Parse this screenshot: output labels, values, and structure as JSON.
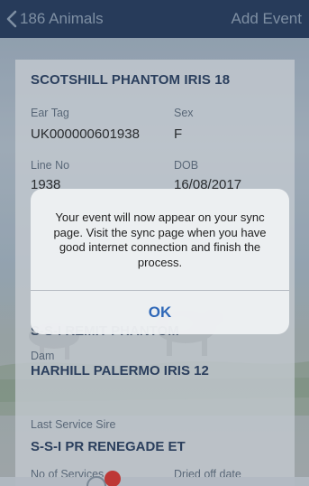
{
  "nav": {
    "back_label": "186 Animals",
    "action_label": "Add Event",
    "back_icon": "chevron-left-icon"
  },
  "animal": {
    "name": "SCOTSHILL PHANTOM IRIS 18",
    "ear_tag_label": "Ear Tag",
    "ear_tag_value": "UK000000601938",
    "sex_label": "Sex",
    "sex_value": "F",
    "line_no_label": "Line No",
    "line_no_value": "1938",
    "dob_label": "DOB",
    "dob_value": "16/08/2017",
    "sire_partial": "S-S-I REMIT PHANTOM",
    "dam_label": "Dam",
    "dam_value": "HARHILL PALERMO IRIS 12",
    "last_service_sire_label": "Last Service Sire",
    "last_service_sire_value": "S-S-I PR RENEGADE ET",
    "no_of_services_label": "No of Services",
    "dried_off_date_label": "Dried off date"
  },
  "alert": {
    "message": "Your event will now appear on your sync page. Visit the sync page when you have good internet connection and finish the process.",
    "ok_label": "OK"
  },
  "colors": {
    "navbar": "#1f3559",
    "accent": "#253a5d",
    "alert_button": "#2f68b8",
    "badge": "#e0312b"
  }
}
